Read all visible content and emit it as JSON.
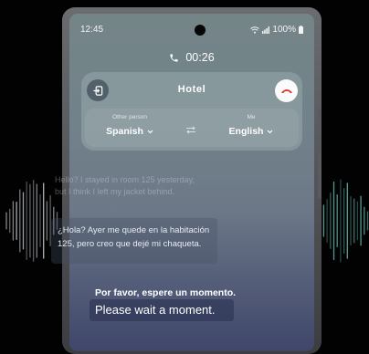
{
  "status_bar": {
    "time": "12:45",
    "battery": "100%"
  },
  "call": {
    "duration": "00:26"
  },
  "header": {
    "title": "Hotel"
  },
  "languages": {
    "other_label": "Other person",
    "other_value": "Spanish",
    "me_label": "Me",
    "me_value": "English"
  },
  "conversation": {
    "original_text": "Hello? I stayed in room 125 yesterday, but I think I left my jacket behind.",
    "translated_text": "¿Hola? Ayer me quede en la habitación 125, pero creo que dejé mi chaqueta.",
    "pending_text": "Por favor, espere un momento.",
    "reply_text": "Please wait a moment."
  },
  "colors": {
    "background": "#020203",
    "hangup_icon": "#d7342a",
    "wave_left": "#c8ccd0",
    "wave_right": "#63b9ad"
  },
  "icons": [
    "phone-icon",
    "exit-icon",
    "hang-up-icon",
    "swap-icon",
    "chevron-down-icon",
    "wifi-icon",
    "signal-icon",
    "battery-icon"
  ]
}
